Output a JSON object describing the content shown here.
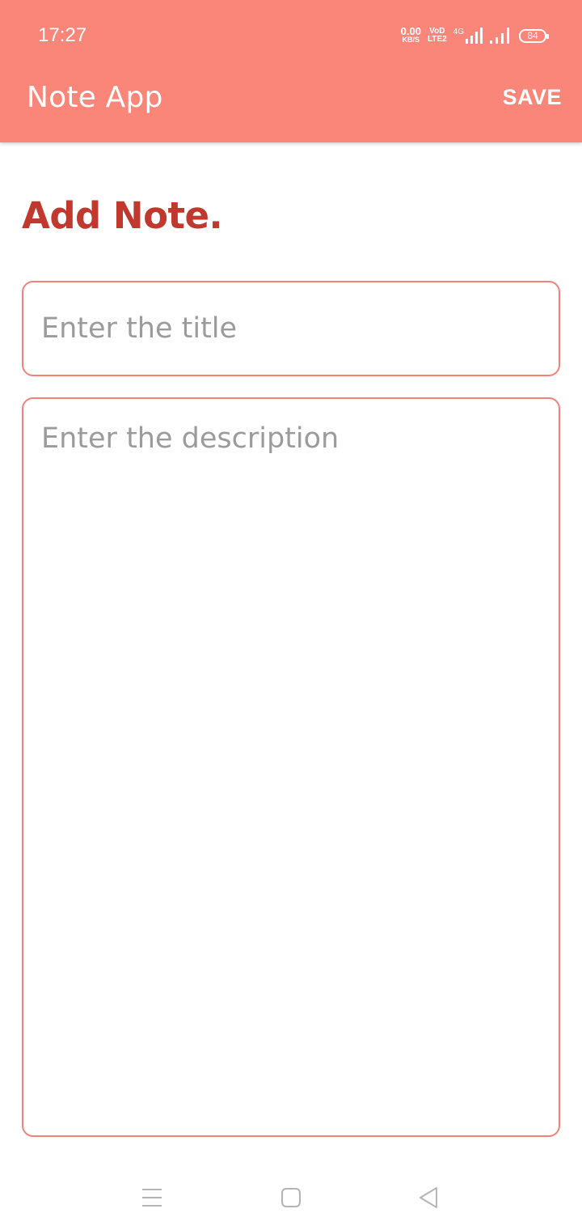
{
  "status_bar": {
    "time": "17:27",
    "net_speed_value": "0.00",
    "net_speed_unit": "KB/S",
    "volte_top": "VoD",
    "volte_bottom": "LTE2",
    "network_type": "4G",
    "battery": "84"
  },
  "app_bar": {
    "title": "Note App",
    "save_label": "SAVE",
    "color": "#fa8579"
  },
  "page": {
    "heading": "Add Note.",
    "heading_color": "#c0382e"
  },
  "form": {
    "title_placeholder": "Enter the title",
    "title_value": "",
    "description_placeholder": "Enter the description",
    "description_value": "",
    "border_color": "#f08378"
  },
  "nav_bar": {
    "icons": [
      "menu-icon",
      "home-square-icon",
      "back-triangle-icon"
    ]
  }
}
